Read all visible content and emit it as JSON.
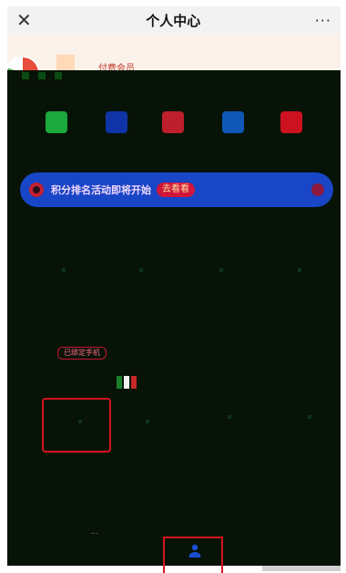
{
  "header": {
    "title": "个人中心",
    "close_icon": "close-icon",
    "more_icon": "more-icon",
    "more_glyph": "···",
    "close_glyph": "✕"
  },
  "profile": {
    "user_tag": "付费会员"
  },
  "quick_actions": [
    {
      "icon": "chat-icon",
      "color": "#1ba83c"
    },
    {
      "icon": "user-card-icon",
      "color": "#0f34a8"
    },
    {
      "icon": "printer-icon",
      "color": "#bd1f2c"
    },
    {
      "icon": "document-icon",
      "color": "#0f58b8"
    },
    {
      "icon": "gift-icon",
      "color": "#cc1220"
    }
  ],
  "banner": {
    "text": "积分排名活动即将开始",
    "cta": "去看看"
  },
  "tags": {
    "red_label": "已绑定手机"
  },
  "colors": {
    "banner": "#1846c6",
    "highlight": "#d5151f",
    "panel": "#061306"
  },
  "footer": {
    "tiny": "..."
  }
}
